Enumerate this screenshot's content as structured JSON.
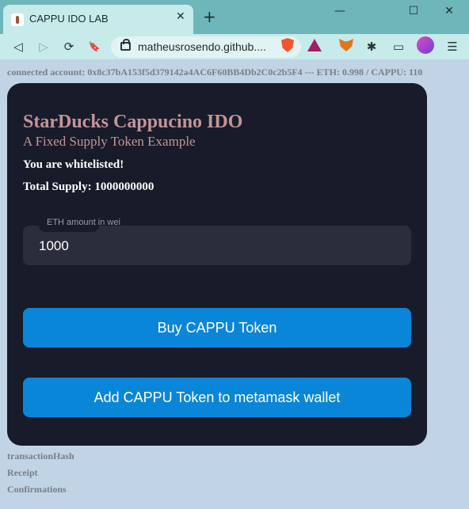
{
  "browser": {
    "tab_title": "CAPPU IDO LAB",
    "tab_close": "✕",
    "new_tab": "+",
    "window_controls": {
      "minimize": "—",
      "maximize": "☐",
      "close": "✕"
    },
    "url": "matheusrosendo.github....",
    "nav": {
      "back": "◁",
      "forward": "▷",
      "reload": "⟳",
      "bookmark": "🔖"
    },
    "extensions": {
      "puzzle": "✱",
      "wallet": "▭",
      "menu": "☰"
    }
  },
  "page": {
    "account_line": "connected account: 0x8c37bA153f5d379142a4AC6F60BB4Db2C0c2b5F4 --- ETH: 0.998 / CAPPU: 110",
    "card": {
      "title": "StarDucks Cappucino IDO",
      "subtitle": "A Fixed Supply Token Example",
      "whitelist_status": "You are whitelisted!",
      "total_supply": "Total Supply: 1000000000",
      "amount_field": {
        "label": "ETH amount in wei",
        "value": "1000"
      },
      "buy_button": "Buy CAPPU Token",
      "add_button": "Add CAPPU Token to metamask wallet"
    },
    "footer": {
      "transaction_hash": "transactionHash",
      "receipt": "Receipt",
      "confirmations": "Confirmations"
    }
  },
  "colors": {
    "card_bg": "#181b2a",
    "title": "#c39595",
    "button": "#0a86d8",
    "page_bg": "#c0d4e5"
  }
}
